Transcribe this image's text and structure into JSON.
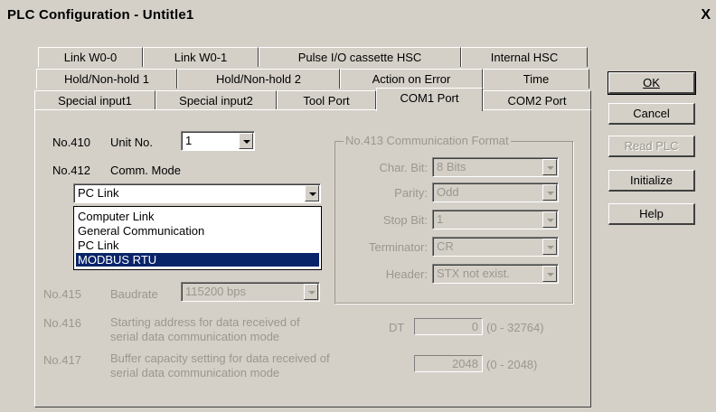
{
  "window": {
    "title": "PLC Configuration - Untitle1",
    "close_label": "X"
  },
  "tabs": {
    "row1": [
      "Link W0-0",
      "Link W0-1",
      "Pulse I/O cassette HSC",
      "Internal HSC"
    ],
    "row2": [
      "Hold/Non-hold 1",
      "Hold/Non-hold 2",
      "Action on Error",
      "Time"
    ],
    "row3": [
      "Special input1",
      "Special input2",
      "Tool Port",
      "COM1 Port",
      "COM2 Port"
    ],
    "active": "COM1 Port"
  },
  "buttons": {
    "ok": "OK",
    "cancel": "Cancel",
    "read_plc": "Read PLC",
    "initialize": "Initialize",
    "help": "Help"
  },
  "form": {
    "no410": {
      "num": "No.410",
      "label": "Unit No.",
      "value": "1"
    },
    "no412": {
      "num": "No.412",
      "label": "Comm. Mode",
      "value": "PC Link",
      "options": [
        "Computer Link",
        "General Communication",
        "PC Link",
        "MODBUS RTU"
      ],
      "selected": "MODBUS RTU"
    },
    "no415": {
      "num": "No.415",
      "label": "Baudrate",
      "value": "115200 bps"
    },
    "no416": {
      "num": "No.416",
      "label1": "Starting address for data received of",
      "label2": "serial data communication mode",
      "prefix": "DT",
      "value": "0",
      "range": "(0 - 32764)"
    },
    "no417": {
      "num": "No.417",
      "label1": "Buffer capacity setting for data received of",
      "label2": "serial data communication mode",
      "value": "2048",
      "range": "(0 - 2048)"
    }
  },
  "comm_format": {
    "title": "No.413 Communication Format",
    "char_bit": {
      "label": "Char. Bit:",
      "value": "8 Bits"
    },
    "parity": {
      "label": "Parity:",
      "value": "Odd"
    },
    "stop_bit": {
      "label": "Stop Bit:",
      "value": "1"
    },
    "terminator": {
      "label": "Terminator:",
      "value": "CR"
    },
    "header": {
      "label": "Header:",
      "value": "STX not exist."
    }
  }
}
